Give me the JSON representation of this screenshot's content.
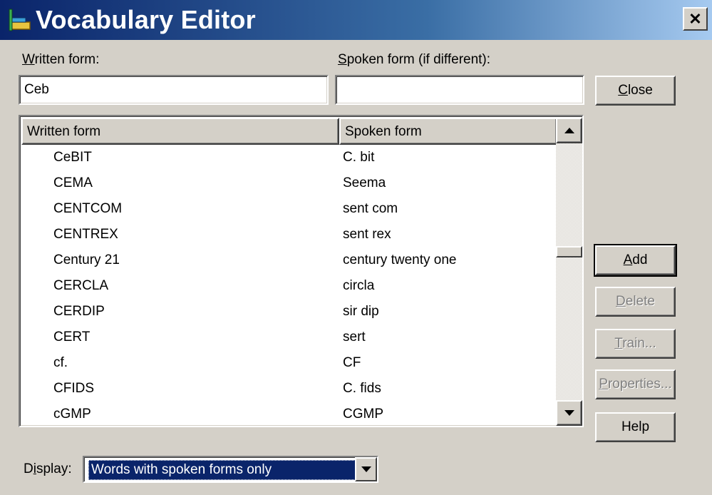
{
  "window": {
    "title": "Vocabulary Editor",
    "close_glyph": "✕",
    "icon": "vocabulary-editor-app-icon"
  },
  "written_form": {
    "label": "Written form:",
    "value": "Ceb",
    "placeholder": ""
  },
  "spoken_form": {
    "label": "Spoken form (if different):",
    "value": "",
    "placeholder": ""
  },
  "list": {
    "columns": [
      "Written form",
      "Spoken form"
    ],
    "rows": [
      {
        "written": "CeBIT",
        "spoken": "C. bit"
      },
      {
        "written": "CEMA",
        "spoken": "Seema"
      },
      {
        "written": "CENTCOM",
        "spoken": "sent com"
      },
      {
        "written": "CENTREX",
        "spoken": "sent rex"
      },
      {
        "written": "Century 21",
        "spoken": "century twenty one"
      },
      {
        "written": "CERCLA",
        "spoken": "circla"
      },
      {
        "written": "CERDIP",
        "spoken": "sir dip"
      },
      {
        "written": "CERT",
        "spoken": "sert"
      },
      {
        "written": "cf.",
        "spoken": "CF"
      },
      {
        "written": "CFIDS",
        "spoken": "C. fids"
      },
      {
        "written": "cGMP",
        "spoken": "CGMP"
      }
    ],
    "scroll_position": 0.42
  },
  "buttons": {
    "close": "Close",
    "add": "Add",
    "delete": "Delete",
    "train": "Train...",
    "properties": "Properties...",
    "help": "Help"
  },
  "display": {
    "label": "Display:",
    "selected": "Words with spoken forms only"
  },
  "colors": {
    "face": "#d4d0c8",
    "title_start": "#0a246a",
    "title_end": "#a6caf0",
    "selection": "#0a246a",
    "disabled_text": "#808080"
  }
}
